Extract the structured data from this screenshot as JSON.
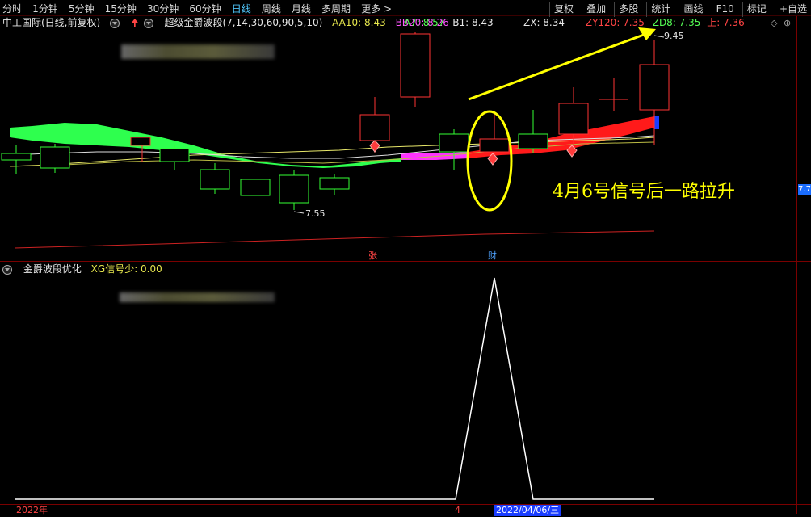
{
  "toolbar": {
    "periods": [
      "分时",
      "1分钟",
      "5分钟",
      "15分钟",
      "30分钟",
      "60分钟",
      "日线",
      "周线",
      "月线",
      "多周期",
      "更多 >"
    ],
    "active_period": "日线",
    "right_buttons": [
      "复权",
      "叠加",
      "多股",
      "统计",
      "画线",
      "F10",
      "标记",
      "+自选"
    ]
  },
  "main_panel": {
    "stock_title": "中工国际(日线,前复权)",
    "indicator_name": "超级金爵波段(7,14,30,60,90,5,10)",
    "values": {
      "aa10": "AA10: 8.43",
      "bb20": "BB20: 8.26",
      "a7": "A7: 8.57",
      "b1": "B1: 8.43",
      "zx": "ZX: 8.34",
      "zy120": "ZY120: 7.35",
      "zd8": "ZD8: 7.35",
      "shang": "上: 7.36"
    },
    "high_label": "9.45",
    "low_label": "7.55",
    "annotation": "4月6号信号后一路拉升",
    "marker_zhang": "张",
    "marker_cai": "财",
    "price_tag": "7.7"
  },
  "sub_panel": {
    "indicator_name": "金爵波段优化",
    "value": "XG信号少: 0.00"
  },
  "date_axis": {
    "year_label": "2022年",
    "month_label": "4",
    "selected_date": "2022/04/06/三"
  },
  "colors": {
    "up": "#ff3333",
    "down": "#33ff33",
    "band_green": "#33ff55",
    "band_red": "#ff1a1a",
    "band_magenta": "#ff33ff",
    "annotation": "#ffff00",
    "accent_blue": "#1a6dff"
  }
}
